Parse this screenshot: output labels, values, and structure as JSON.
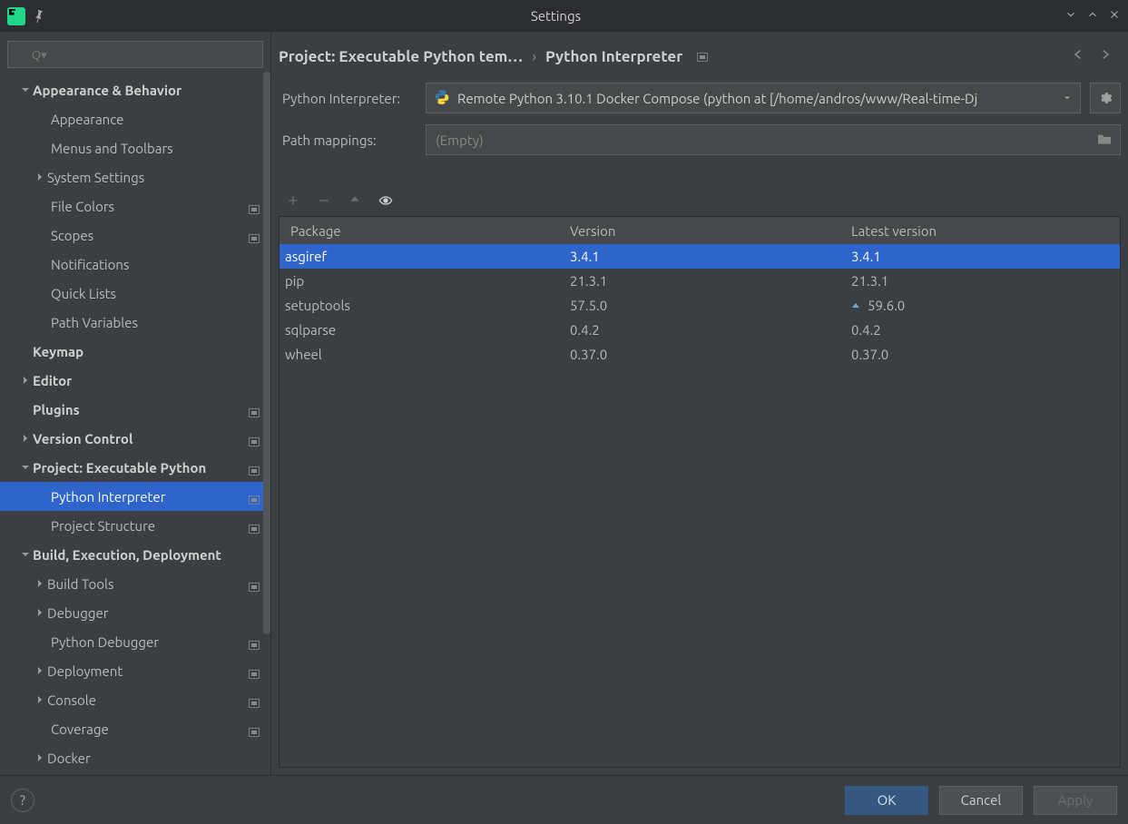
{
  "titlebar": {
    "title": "Settings"
  },
  "search": {
    "placeholder": "Q▾"
  },
  "tree": {
    "items": [
      {
        "label": "Appearance & Behavior",
        "bold": true,
        "arrow": "down",
        "indent": 0
      },
      {
        "label": "Appearance",
        "indent": 1
      },
      {
        "label": "Menus and Toolbars",
        "indent": 1
      },
      {
        "label": "System Settings",
        "arrow": "right",
        "indent": 0,
        "arrowIndent": true
      },
      {
        "label": "File Colors",
        "indent": 1,
        "marker": true
      },
      {
        "label": "Scopes",
        "indent": 1,
        "marker": true
      },
      {
        "label": "Notifications",
        "indent": 1
      },
      {
        "label": "Quick Lists",
        "indent": 1
      },
      {
        "label": "Path Variables",
        "indent": 1
      },
      {
        "label": "Keymap",
        "bold": true,
        "indent": 0,
        "noarrow": true
      },
      {
        "label": "Editor",
        "bold": true,
        "arrow": "right",
        "indent": 0
      },
      {
        "label": "Plugins",
        "bold": true,
        "indent": 0,
        "noarrow": true,
        "marker": true
      },
      {
        "label": "Version Control",
        "bold": true,
        "arrow": "right",
        "indent": 0,
        "marker": true
      },
      {
        "label": "Project: Executable Python",
        "bold": true,
        "arrow": "down",
        "indent": 0,
        "marker": true
      },
      {
        "label": "Python Interpreter",
        "indent": 1,
        "marker": true,
        "selected": true
      },
      {
        "label": "Project Structure",
        "indent": 1,
        "marker": true
      },
      {
        "label": "Build, Execution, Deployment",
        "bold": true,
        "arrow": "down",
        "indent": 0
      },
      {
        "label": "Build Tools",
        "arrow": "right",
        "indent": 0,
        "arrowIndent": true,
        "marker": true
      },
      {
        "label": "Debugger",
        "arrow": "right",
        "indent": 0,
        "arrowIndent": true
      },
      {
        "label": "Python Debugger",
        "indent": 1,
        "marker": true
      },
      {
        "label": "Deployment",
        "arrow": "right",
        "indent": 0,
        "arrowIndent": true,
        "marker": true
      },
      {
        "label": "Console",
        "arrow": "right",
        "indent": 0,
        "arrowIndent": true,
        "marker": true
      },
      {
        "label": "Coverage",
        "indent": 1,
        "marker": true
      },
      {
        "label": "Docker",
        "arrow": "right",
        "indent": 0,
        "arrowIndent": true
      }
    ]
  },
  "breadcrumb": {
    "crumb1": "Project: Executable Python tem…",
    "crumb2": "Python Interpreter"
  },
  "interpreter": {
    "label": "Python Interpreter:",
    "value": "Remote Python 3.10.1 Docker Compose (python at [/home/andros/www/Real-time-Dj"
  },
  "paths": {
    "label": "Path mappings:",
    "value": "(Empty)"
  },
  "packages": {
    "headers": {
      "pkg": "Package",
      "ver": "Version",
      "lat": "Latest version"
    },
    "rows": [
      {
        "pkg": "asgiref",
        "ver": "3.4.1",
        "lat": "3.4.1",
        "selected": true
      },
      {
        "pkg": "pip",
        "ver": "21.3.1",
        "lat": "21.3.1"
      },
      {
        "pkg": "setuptools",
        "ver": "57.5.0",
        "lat": "59.6.0",
        "update": true
      },
      {
        "pkg": "sqlparse",
        "ver": "0.4.2",
        "lat": "0.4.2"
      },
      {
        "pkg": "wheel",
        "ver": "0.37.0",
        "lat": "0.37.0"
      }
    ]
  },
  "footer": {
    "ok": "OK",
    "cancel": "Cancel",
    "apply": "Apply",
    "help": "?"
  }
}
